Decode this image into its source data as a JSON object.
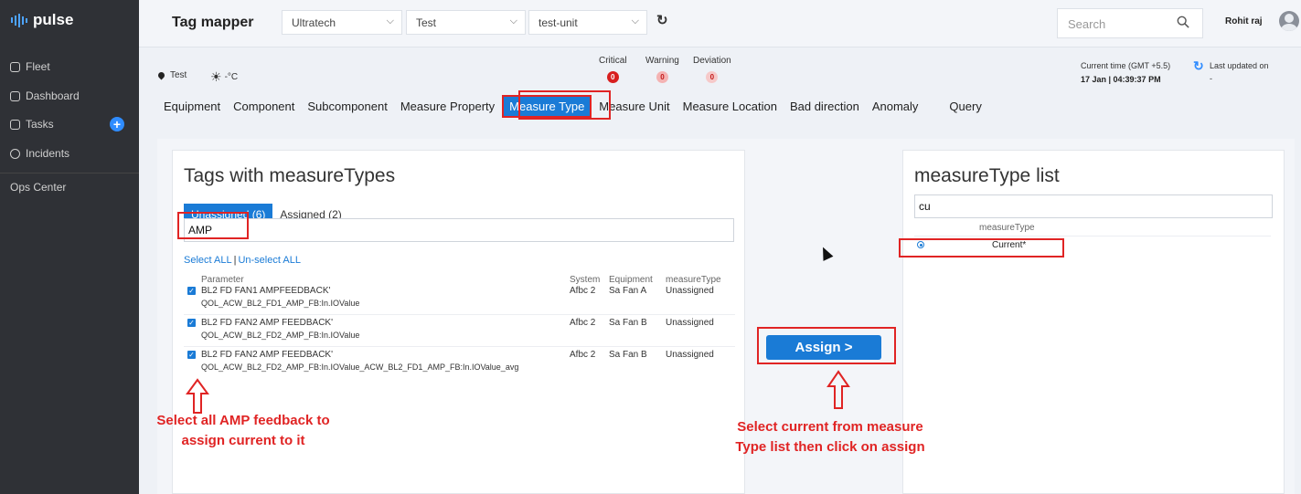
{
  "sidebar": {
    "logo": "pulse",
    "items": [
      {
        "label": "Fleet"
      },
      {
        "label": "Dashboard"
      },
      {
        "label": "Tasks"
      },
      {
        "label": "Incidents"
      }
    ],
    "plus": "+",
    "ops_center": "Ops Center"
  },
  "header": {
    "title": "Tag mapper",
    "selects": [
      "Ultratech",
      "Test",
      "test-unit"
    ],
    "refresh_icon": "↻",
    "search_placeholder": "Search",
    "user": "Rohit raj"
  },
  "info": {
    "location": "Test",
    "temperature": "-°C",
    "alerts": [
      {
        "label": "Critical",
        "count": "0",
        "color": "#d81f1f"
      },
      {
        "label": "Warning",
        "count": "0",
        "color": "#f4b3b3"
      },
      {
        "label": "Deviation",
        "count": "0",
        "color": "#f6c9c9"
      }
    ],
    "current_time_label": "Current time (GMT +5.5)",
    "current_time": "17 Jan | 04:39:37 PM",
    "last_updated_label": "Last updated on",
    "last_updated": "-"
  },
  "tabs": [
    "Equipment",
    "Component",
    "Subcomponent",
    "Measure Property",
    "Measure Type",
    "Measure Unit",
    "Measure Location",
    "Bad direction",
    "Anomaly",
    "Query"
  ],
  "active_tab": "Measure Type",
  "left_panel": {
    "title": "Tags with measureTypes",
    "subtabs": [
      "Unassigned (6)",
      "Assigned (2)"
    ],
    "filter_value": "AMP",
    "select_all": "Select ALL",
    "separator": "|",
    "unselect_all": "Un-select ALL",
    "columns": [
      "Parameter",
      "System",
      "Equipment",
      "measureType"
    ],
    "rows": [
      {
        "p1": "BL2 FD FAN1 AMPFEEDBACK'",
        "p2": "QOL_ACW_BL2_FD1_AMP_FB:In.IOValue",
        "system": "Afbc 2",
        "equipment": "Sa Fan A",
        "measure_type": "Unassigned"
      },
      {
        "p1": "BL2 FD FAN2 AMP FEEDBACK'",
        "p2": "QOL_ACW_BL2_FD2_AMP_FB:In.IOValue",
        "system": "Afbc 2",
        "equipment": "Sa Fan B",
        "measure_type": "Unassigned"
      },
      {
        "p1": "BL2 FD FAN2 AMP FEEDBACK'",
        "p2": "QOL_ACW_BL2_FD2_AMP_FB:In.IOValue_ACW_BL2_FD1_AMP_FB:In.IOValue_avg",
        "system": "Afbc 2",
        "equipment": "Sa Fan B",
        "measure_type": "Unassigned"
      }
    ]
  },
  "assign_button": "Assign >",
  "right_panel": {
    "title": "measureType list",
    "filter_value": "cu",
    "column": "measureType",
    "item": "Current*"
  },
  "annotations": {
    "left_line1": "Select all AMP feedback to",
    "left_line2": "assign current to it",
    "right_line1": "Select current from measure",
    "right_line2": "Type list then click on assign"
  }
}
